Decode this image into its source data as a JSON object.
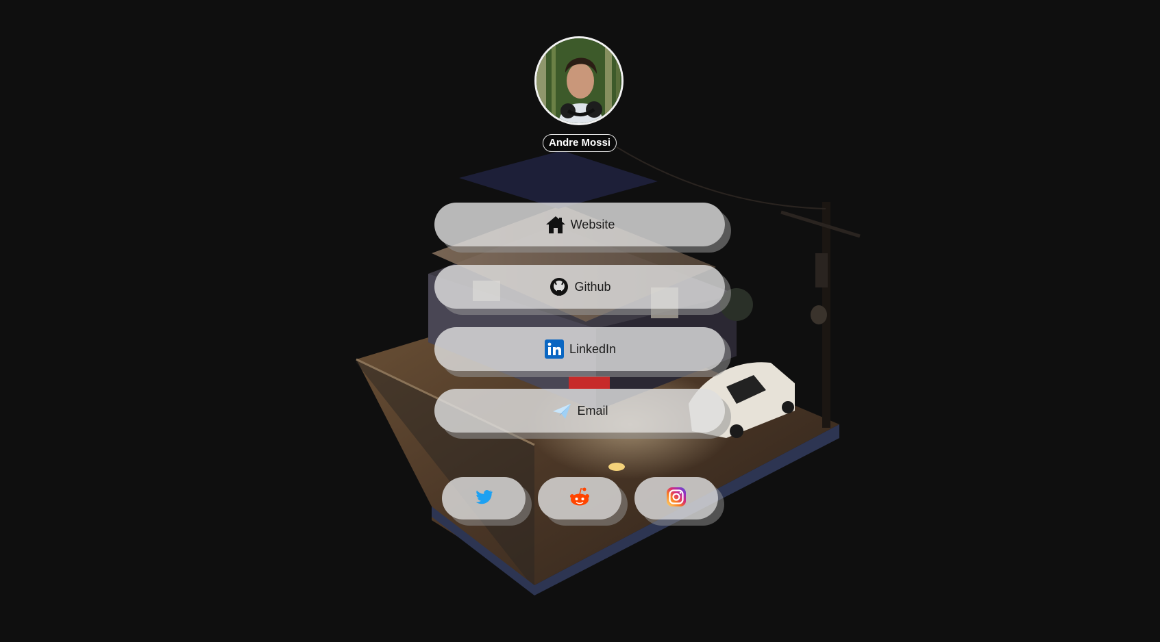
{
  "profile": {
    "name": "Andre Mossi",
    "avatar_icon": "profile-photo"
  },
  "links": [
    {
      "label": "Website",
      "icon": "home-icon"
    },
    {
      "label": "Github",
      "icon": "github-icon"
    },
    {
      "label": "LinkedIn",
      "icon": "linkedin-icon"
    },
    {
      "label": "Email",
      "icon": "paper-plane-icon"
    }
  ],
  "social": [
    {
      "icon": "twitter-icon",
      "color": "#1DA1F2"
    },
    {
      "icon": "reddit-icon",
      "color": "#FF4500"
    },
    {
      "icon": "instagram-icon",
      "color": "#E1306C"
    }
  ],
  "colors": {
    "background": "#0f0f0f",
    "button": "#dedede",
    "button_shadow": "#969696"
  }
}
